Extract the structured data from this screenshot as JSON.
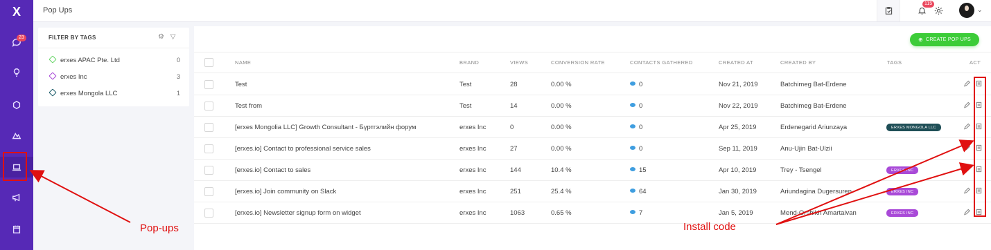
{
  "header": {
    "title": "Pop Ups",
    "notification_count": "115",
    "icons": [
      "clipboard-icon",
      "bell-icon",
      "gear-icon"
    ]
  },
  "nav": {
    "logo": "X",
    "inbox_badge": "23",
    "items": [
      "inbox",
      "ideas",
      "tickets",
      "deals",
      "pop-ups",
      "campaigns",
      "calendar"
    ]
  },
  "filter": {
    "title": "FILTER BY TAGS",
    "tags": [
      {
        "name": "erxes APAC Pte. Ltd",
        "count": "0",
        "color": "#6bd66b"
      },
      {
        "name": "erxes Inc",
        "count": "3",
        "color": "#a94ad8"
      },
      {
        "name": "erxes Mongola LLC",
        "count": "1",
        "color": "#1f5e6b"
      }
    ]
  },
  "toolbar": {
    "create_label": "CREATE POP UPS"
  },
  "table": {
    "columns": [
      "NAME",
      "BRAND",
      "VIEWS",
      "CONVERSION RATE",
      "CONTACTS GATHERED",
      "CREATED AT",
      "CREATED BY",
      "TAGS",
      "ACT"
    ],
    "rows": [
      {
        "name": "Test",
        "brand": "Test",
        "views": "28",
        "rate": "0.00 %",
        "contacts": "0",
        "created_at": "Nov 21, 2019",
        "created_by": "Batchimeg Bat-Erdene",
        "tag": "",
        "tag_color": ""
      },
      {
        "name": "Test from",
        "brand": "Test",
        "views": "14",
        "rate": "0.00 %",
        "contacts": "0",
        "created_at": "Nov 22, 2019",
        "created_by": "Batchimeg Bat-Erdene",
        "tag": "",
        "tag_color": ""
      },
      {
        "name": "[erxes Mongolia LLC] Growth Consultant - Бүртгэлийн форум",
        "brand": "erxes Inc",
        "views": "0",
        "rate": "0.00 %",
        "contacts": "0",
        "created_at": "Apr 25, 2019",
        "created_by": "Erdenegarid Ariunzaya",
        "tag": "ERXES MONGOLA LLC",
        "tag_color": "#1f4f57"
      },
      {
        "name": "[erxes.io] Contact to professional service sales",
        "brand": "erxes Inc",
        "views": "27",
        "rate": "0.00 %",
        "contacts": "0",
        "created_at": "Sep 11, 2019",
        "created_by": "Anu-Ujin Bat-Ulzii",
        "tag": "",
        "tag_color": ""
      },
      {
        "name": "[erxes.io] Contact to sales",
        "brand": "erxes Inc",
        "views": "144",
        "rate": "10.4 %",
        "contacts": "15",
        "created_at": "Apr 10, 2019",
        "created_by": "Trey - Tsengel",
        "tag": "ERXES INC",
        "tag_color": "#a94ad8"
      },
      {
        "name": "[erxes.io] Join community on Slack",
        "brand": "erxes Inc",
        "views": "251",
        "rate": "25.4 %",
        "contacts": "64",
        "created_at": "Jan 30, 2019",
        "created_by": "Ariundagina Dugersuren",
        "tag": "ERXES INC",
        "tag_color": "#a94ad8"
      },
      {
        "name": "[erxes.io] Newsletter signup form on widget",
        "brand": "erxes Inc",
        "views": "1063",
        "rate": "0.65 %",
        "contacts": "7",
        "created_at": "Jan 5, 2019",
        "created_by": "Mend-Orshikh Amartaivan",
        "tag": "ERXES INC",
        "tag_color": "#a94ad8"
      }
    ]
  },
  "annotations": {
    "popups_label": "Pop-ups",
    "install_label": "Install code",
    "color": "#e01010"
  }
}
